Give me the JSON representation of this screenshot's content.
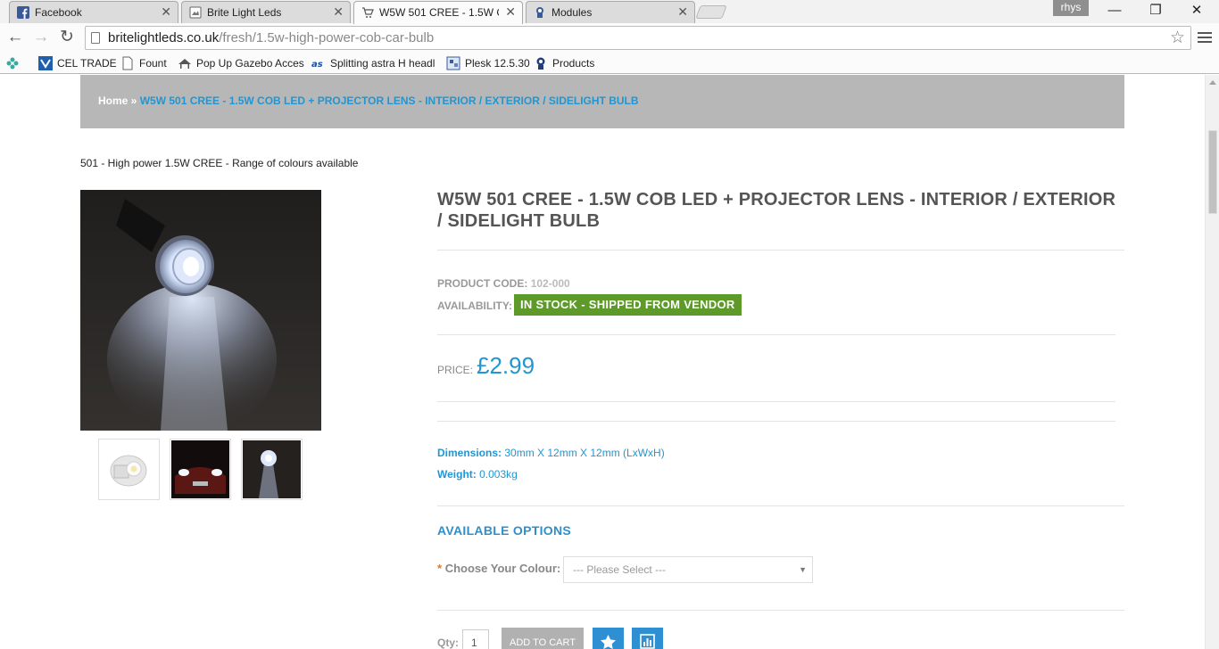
{
  "browser": {
    "tabs": [
      {
        "title": "Facebook",
        "icon": "facebook-icon"
      },
      {
        "title": "Brite Light Leds",
        "icon": "page-icon"
      },
      {
        "title": "W5W 501 CREE - 1.5W CO",
        "icon": "cart-icon",
        "active": true
      },
      {
        "title": "Modules",
        "icon": "plesk-icon"
      }
    ],
    "profile_name": "rhys",
    "window_controls": {
      "minimize": "—",
      "restore": "❐",
      "close": "✕"
    },
    "address": {
      "host": "britelightleds.co.uk",
      "path": "/fresh/1.5w-high-power-cob-car-bulb"
    },
    "bookmarks": [
      {
        "label": "CEL TRADE",
        "icon": "cel-icon"
      },
      {
        "label": "Fount",
        "icon": "page-icon"
      },
      {
        "label": "Pop Up Gazebo Acces",
        "icon": "gazebo-icon"
      },
      {
        "label": "Splitting astra H headl",
        "icon": "as-icon"
      },
      {
        "label": "Plesk 12.5.30",
        "icon": "plesk-icon"
      },
      {
        "label": "Products",
        "icon": "plesk-icon"
      }
    ]
  },
  "breadcrumb": {
    "home": "Home",
    "separator": " » ",
    "current": "W5W 501 CREE - 1.5W COB LED + PROJECTOR LENS - INTERIOR / EXTERIOR / SIDELIGHT BULB"
  },
  "product": {
    "subtitle": "501 - High power 1.5W CREE - Range of colours available",
    "title": "W5W 501 CREE - 1.5W COB LED + PROJECTOR LENS - INTERIOR / EXTERIOR / SIDELIGHT BULB",
    "code_label": "PRODUCT CODE:",
    "code": "102-000",
    "availability_label": "AVAILABILITY:",
    "availability": "IN STOCK - SHIPPED FROM VENDOR",
    "price_label": "PRICE:",
    "price": "£2.99",
    "dimensions_label": "Dimensions:",
    "dimensions": "30mm X 12mm X 12mm (LxWxH)",
    "weight_label": "Weight:",
    "weight": "0.003kg",
    "options_title": "AVAILABLE OPTIONS",
    "colour_label": "Choose Your Colour:",
    "required_mark": "*",
    "colour_placeholder": "--- Please Select ---",
    "qty_label": "Qty:",
    "qty": "1",
    "add_to_cart": "ADD TO CART"
  },
  "colors": {
    "accent": "#2196d3",
    "stock_green": "#5d9a2a",
    "breadcrumb_bg": "#b7b7b7"
  }
}
